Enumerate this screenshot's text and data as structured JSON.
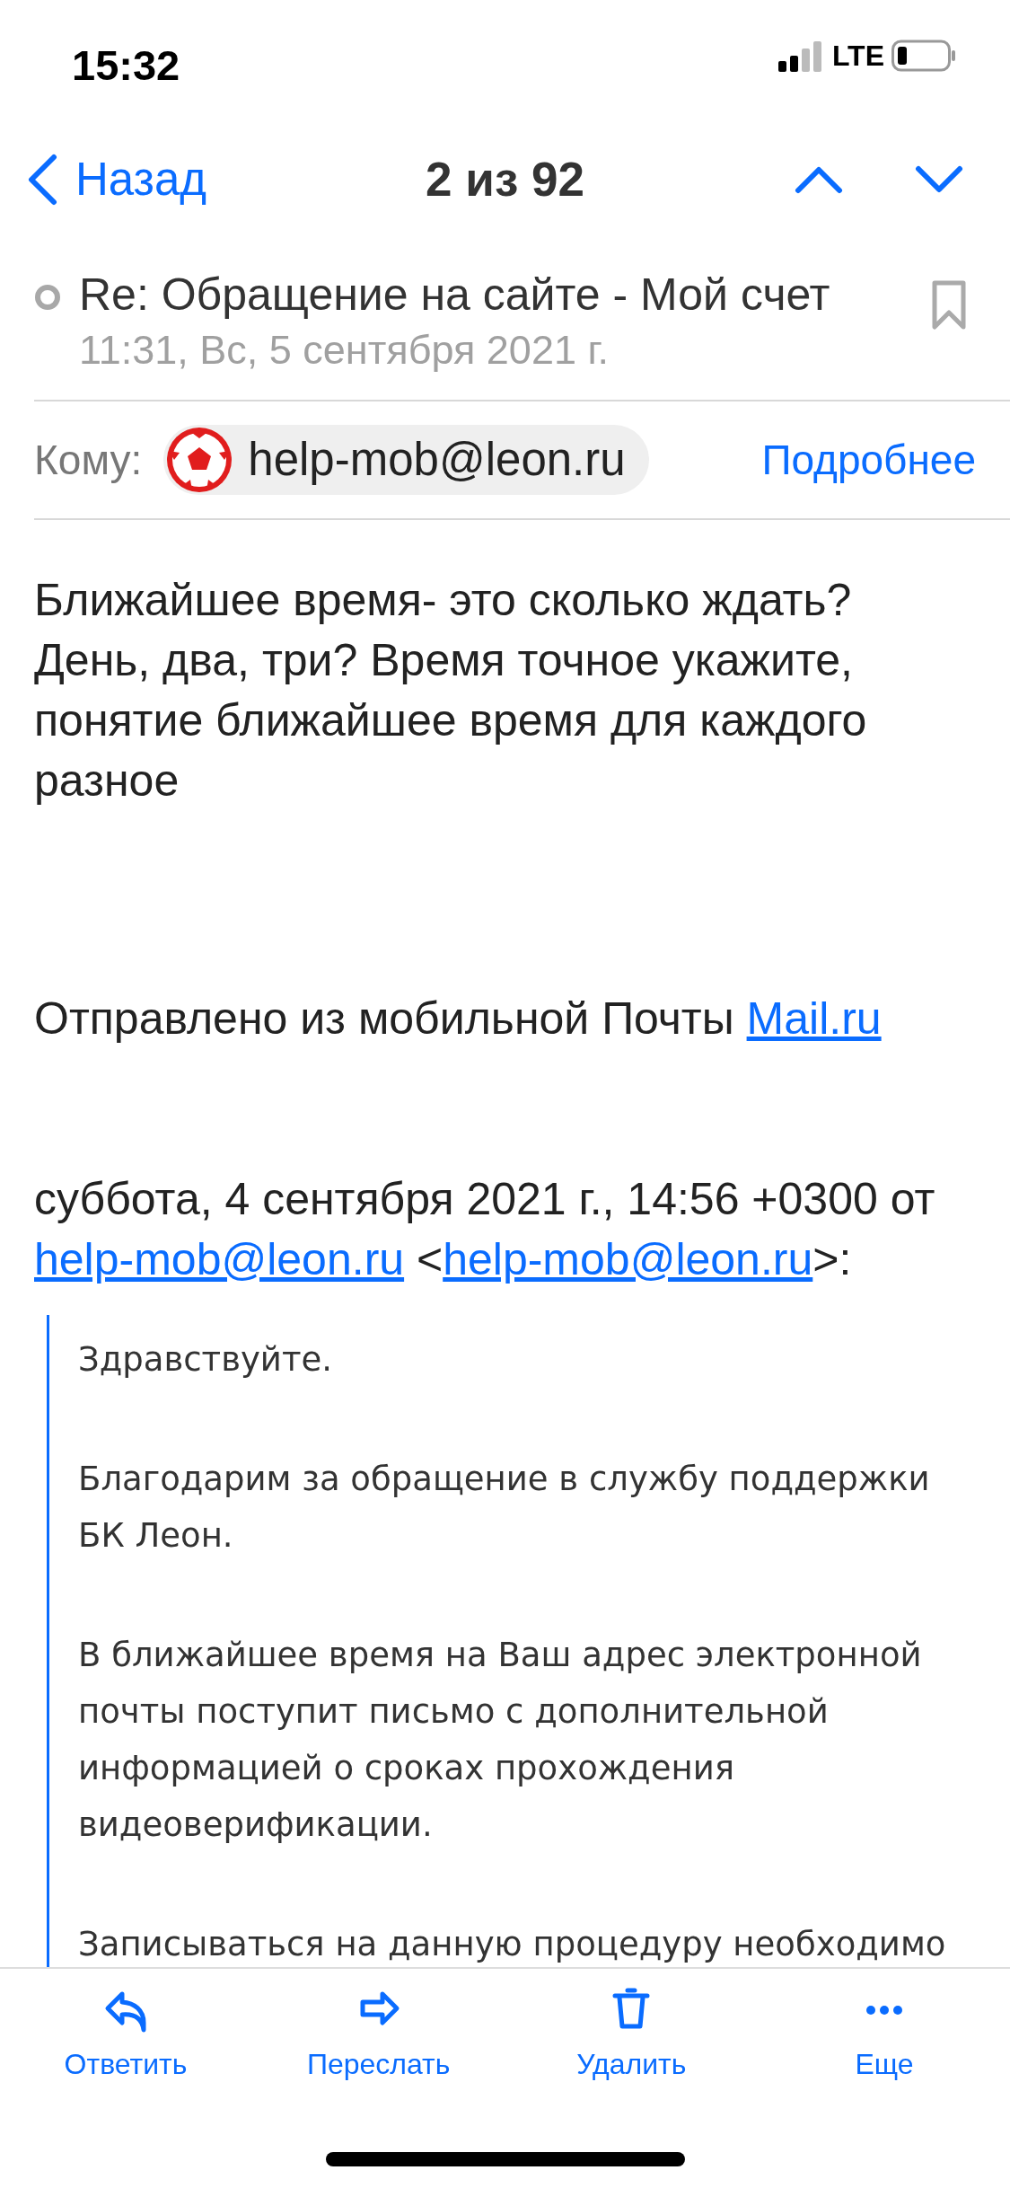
{
  "status_bar": {
    "time": "15:32",
    "network": "LTE"
  },
  "nav": {
    "back": "Назад",
    "position": "2 из 92"
  },
  "message": {
    "subject": "Re: Обращение на сайте - Мой счет",
    "read": true,
    "flagged": false,
    "date": "11:31, Вс, 5 сентября 2021 г.",
    "to_label": "Кому:",
    "recipient": "help-mob@leon.ru",
    "details": "Подробнее"
  },
  "body": {
    "lines": [
      "Ближайшее время- это сколько ждать?",
      "День, два, три? Время точное укажите,",
      "понятие ближайшее время для каждого",
      "разное"
    ],
    "signature": [
      {
        "kind": "text",
        "text": "Отправлено из мобильной Почты "
      },
      {
        "kind": "link",
        "text": "Mail.ru"
      }
    ],
    "quote_header": [
      {
        "kind": "text",
        "text": "суббота, 4 сентября 2021 г., 14:56 +0300 от "
      },
      {
        "kind": "link",
        "text": "help-mob@leon.ru"
      },
      {
        "kind": "text",
        "text": " <"
      },
      {
        "kind": "link",
        "text": "help-mob@leon.ru"
      },
      {
        "kind": "text",
        "text": ">:"
      }
    ],
    "quote": [
      [
        "Здравствуйте."
      ],
      [
        "Благодарим за обращение в службу поддержки",
        "БК Леон."
      ],
      [
        "В ближайшее время на Ваш адрес электронной",
        "почты поступит письмо с дополнительной",
        "информацией о сроках прохождения",
        "видеоверификации."
      ],
      [
        "Записываться на данную процедуру необходимо"
      ]
    ]
  },
  "toolbar": [
    {
      "kind": "reply",
      "label": "Ответить"
    },
    {
      "kind": "forward",
      "label": "Переслать"
    },
    {
      "kind": "delete",
      "label": "Удалить"
    },
    {
      "kind": "more",
      "label": "Еще"
    }
  ]
}
